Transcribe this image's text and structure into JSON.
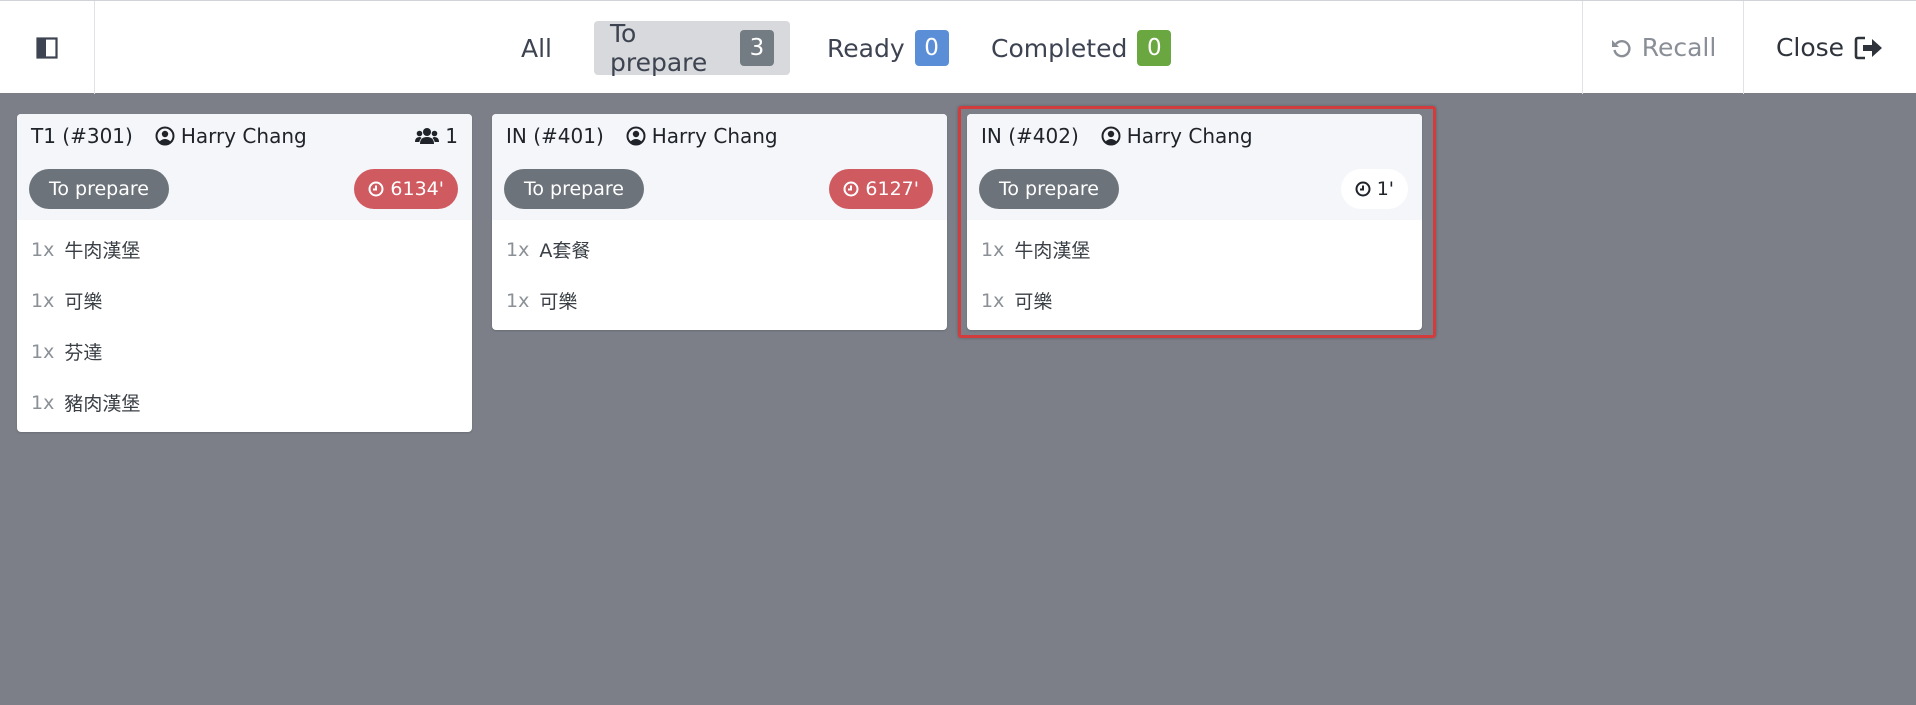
{
  "header": {
    "tabs": [
      {
        "label": "All",
        "count": null
      },
      {
        "label": "To prepare",
        "count": "3"
      },
      {
        "label": "Ready",
        "count": "0"
      },
      {
        "label": "Completed",
        "count": "0"
      }
    ],
    "recall_label": "Recall",
    "close_label": "Close"
  },
  "orders": [
    {
      "title": "T1 (#301)",
      "customer": "Harry Chang",
      "guests": "1",
      "state": "To prepare",
      "timer": "6134'",
      "lines": [
        {
          "qty": "1x",
          "name": "牛肉漢堡"
        },
        {
          "qty": "1x",
          "name": "可樂"
        },
        {
          "qty": "1x",
          "name": "芬達"
        },
        {
          "qty": "1x",
          "name": "豬肉漢堡"
        }
      ]
    },
    {
      "title": "IN (#401)",
      "customer": "Harry Chang",
      "state": "To prepare",
      "timer": "6127'",
      "lines": [
        {
          "qty": "1x",
          "name": "A套餐"
        },
        {
          "qty": "1x",
          "name": "可樂"
        }
      ]
    },
    {
      "title": "IN (#402)",
      "customer": "Harry Chang",
      "state": "To prepare",
      "timer": "1'",
      "lines": [
        {
          "qty": "1x",
          "name": "牛肉漢堡"
        },
        {
          "qty": "1x",
          "name": "可樂"
        }
      ]
    }
  ],
  "colors": {
    "accent_late": "#cf5a60",
    "badge_blue": "#5a8fd8",
    "badge_green": "#6aa740",
    "highlight_border": "#d23c3c"
  }
}
